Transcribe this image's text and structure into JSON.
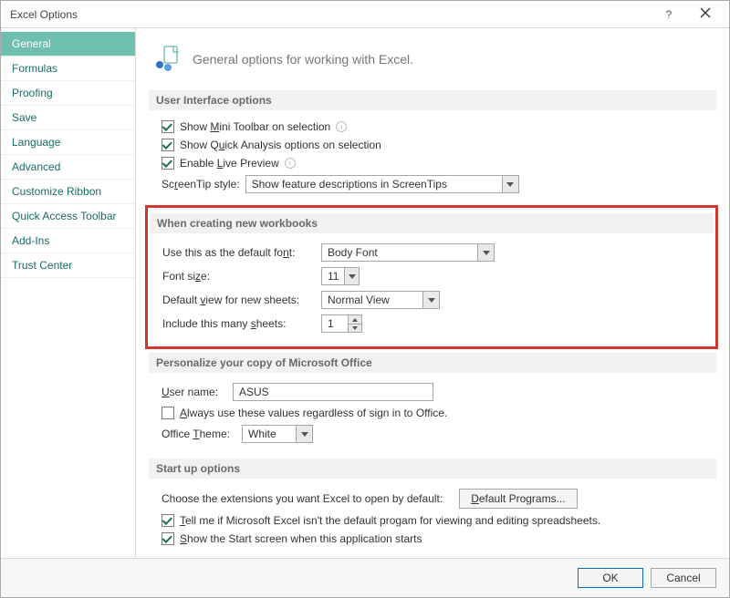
{
  "title": "Excel Options",
  "sidebar": {
    "items": [
      {
        "label": "General",
        "active": true
      },
      {
        "label": "Formulas"
      },
      {
        "label": "Proofing"
      },
      {
        "label": "Save"
      },
      {
        "label": "Language"
      },
      {
        "label": "Advanced"
      },
      {
        "label": "Customize Ribbon"
      },
      {
        "label": "Quick Access Toolbar"
      },
      {
        "label": "Add-Ins"
      },
      {
        "label": "Trust Center"
      }
    ]
  },
  "heading": "General options for working with Excel.",
  "sections": {
    "ui": {
      "title": "User Interface options",
      "mini_toolbar": {
        "pre": "Show ",
        "u": "M",
        "post": "ini Toolbar on selection"
      },
      "quick_analysis": {
        "pre": "Show Q",
        "u": "u",
        "post": "ick Analysis options on selection"
      },
      "live_preview": {
        "pre": "Enable ",
        "u": "L",
        "post": "ive Preview"
      },
      "screentip_label": {
        "pre": "Sc",
        "u": "r",
        "post": "eenTip style:"
      },
      "screentip_value": "Show feature descriptions in ScreenTips"
    },
    "newwb": {
      "title": "When creating new workbooks",
      "font_label": {
        "pre": "Use this as the default fo",
        "u": "n",
        "post": "t:"
      },
      "font_value": "Body Font",
      "size_label": {
        "pre": "Font si",
        "u": "z",
        "post": "e:"
      },
      "size_value": "11",
      "view_label": {
        "pre": "Default ",
        "u": "v",
        "post": "iew for new sheets:"
      },
      "view_value": "Normal View",
      "sheets_label": {
        "pre": "Include this many ",
        "u": "s",
        "post": "heets:"
      },
      "sheets_value": "1"
    },
    "personalize": {
      "title": "Personalize your copy of Microsoft Office",
      "username_label": {
        "u": "U",
        "post": "ser name:"
      },
      "username_value": "ASUS",
      "always_label": {
        "u": "A",
        "post": "lways use these values regardless of sign in to Office."
      },
      "theme_label": {
        "pre": "Office ",
        "u": "T",
        "post": "heme:"
      },
      "theme_value": "White"
    },
    "startup": {
      "title": "Start up options",
      "choose_label": "Choose the extensions you want Excel to open by default:",
      "default_programs_btn": {
        "u": "D",
        "post": "efault Programs..."
      },
      "tellme": {
        "u": "T",
        "post": "ell me if Microsoft Excel isn't the default progam for viewing and editing spreadsheets."
      },
      "startscreen": {
        "u": "S",
        "post": "how the Start screen when this application starts"
      }
    }
  },
  "footer": {
    "ok": "OK",
    "cancel": "Cancel"
  }
}
